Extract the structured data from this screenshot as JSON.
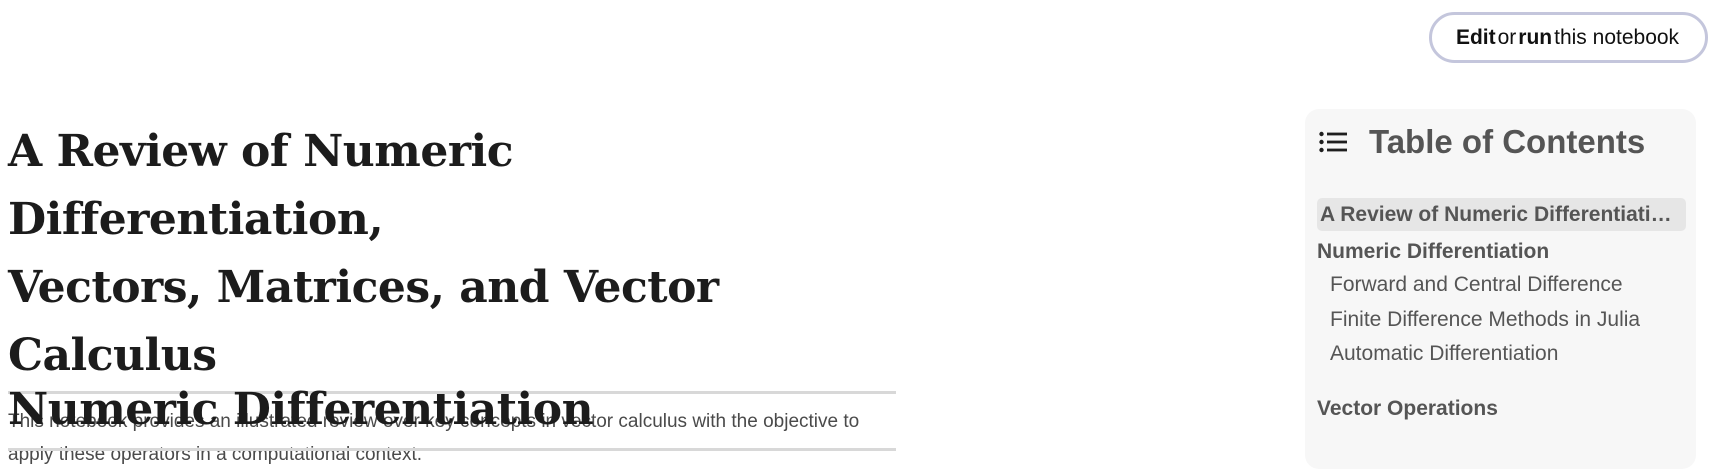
{
  "edit_button": {
    "strong1": "Edit",
    "mid": "or",
    "strong2": "run",
    "rest": "this notebook"
  },
  "main": {
    "title_line1": "A Review of Numeric Differentiation,",
    "title_line2": "Vectors, Matrices, and Vector Calculus",
    "intro": "This notebook provides an illustrated review over key concepts in vector calculus with the objective to apply these operators in a computational context.",
    "section_heading": "Numeric Differentiation"
  },
  "toc": {
    "icon": "list-icon",
    "title": "Table of Contents",
    "items": [
      {
        "label": "A Review of Numeric Differentiation, Vectors, Matrices, and Vector Calculus",
        "level": 1,
        "active": true
      },
      {
        "label": "Numeric Differentiation",
        "level": 1,
        "active": false
      },
      {
        "label": "Forward and Central Difference",
        "level": 2,
        "active": false
      },
      {
        "label": "Finite Difference Methods in Julia",
        "level": 2,
        "active": false
      },
      {
        "label": "Automatic Differentiation",
        "level": 2,
        "active": false
      },
      {
        "label": "Vector Operations",
        "level": 1,
        "active": false
      }
    ]
  }
}
